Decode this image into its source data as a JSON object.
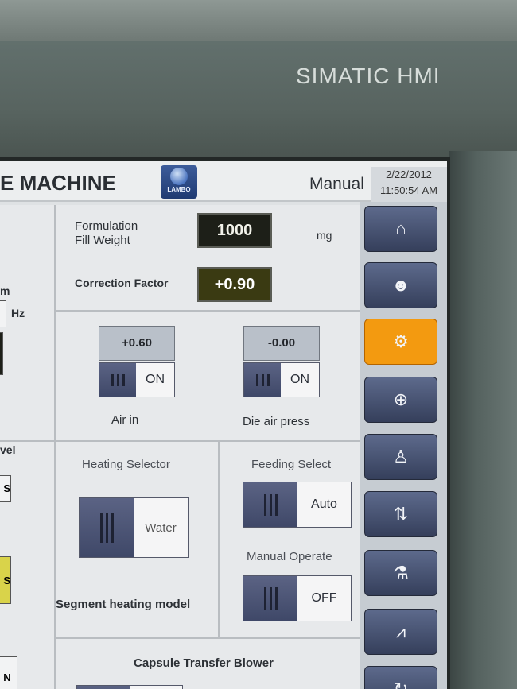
{
  "bezel": {
    "brand": "SIMATIC HMI"
  },
  "header": {
    "title": "E MACHINE",
    "logo_text": "LAMBO",
    "mode": "Manual",
    "date": "2/22/2012",
    "time": "11:50:54 AM"
  },
  "left": {
    "unit_m": "m",
    "unit_hz": "Hz",
    "vel": "vel",
    "s1": "S",
    "s2": "S",
    "n": "N"
  },
  "formulation": {
    "fill_weight_label_1": "Formulation",
    "fill_weight_label_2": "Fill Weight",
    "fill_weight_value": "1000",
    "fill_weight_unit": "mg",
    "correction_label": "Correction Factor",
    "correction_value": "+0.90"
  },
  "air_in": {
    "value": "+0.60",
    "state": "ON",
    "label": "Air in"
  },
  "die_air": {
    "value": "-0.00",
    "state": "ON",
    "label": "Die air press"
  },
  "heating": {
    "label": "Heating Selector",
    "state": "Water",
    "model_label": "Segment heating model"
  },
  "feeding": {
    "label": "Feeding Select",
    "state": "Auto"
  },
  "manual_operate": {
    "label": "Manual Operate",
    "state": "OFF"
  },
  "capsule": {
    "label": "Capsule Transfer Blower"
  },
  "nav": {
    "items": [
      {
        "icon": "home-icon",
        "glyph": "⌂"
      },
      {
        "icon": "operator-icon",
        "glyph": "☻"
      },
      {
        "icon": "tools-settings-icon",
        "glyph": "⚙"
      },
      {
        "icon": "pressure-gauge-icon",
        "glyph": "⊕"
      },
      {
        "icon": "user-icon",
        "glyph": "♙"
      },
      {
        "icon": "sort-icon",
        "glyph": "⇅"
      },
      {
        "icon": "test-tube-icon",
        "glyph": "⚗"
      },
      {
        "icon": "trend-chart-icon",
        "glyph": "⩘"
      },
      {
        "icon": "refresh-icon",
        "glyph": "↻"
      }
    ],
    "active_index": 2,
    "active_color": "#f39a10"
  }
}
